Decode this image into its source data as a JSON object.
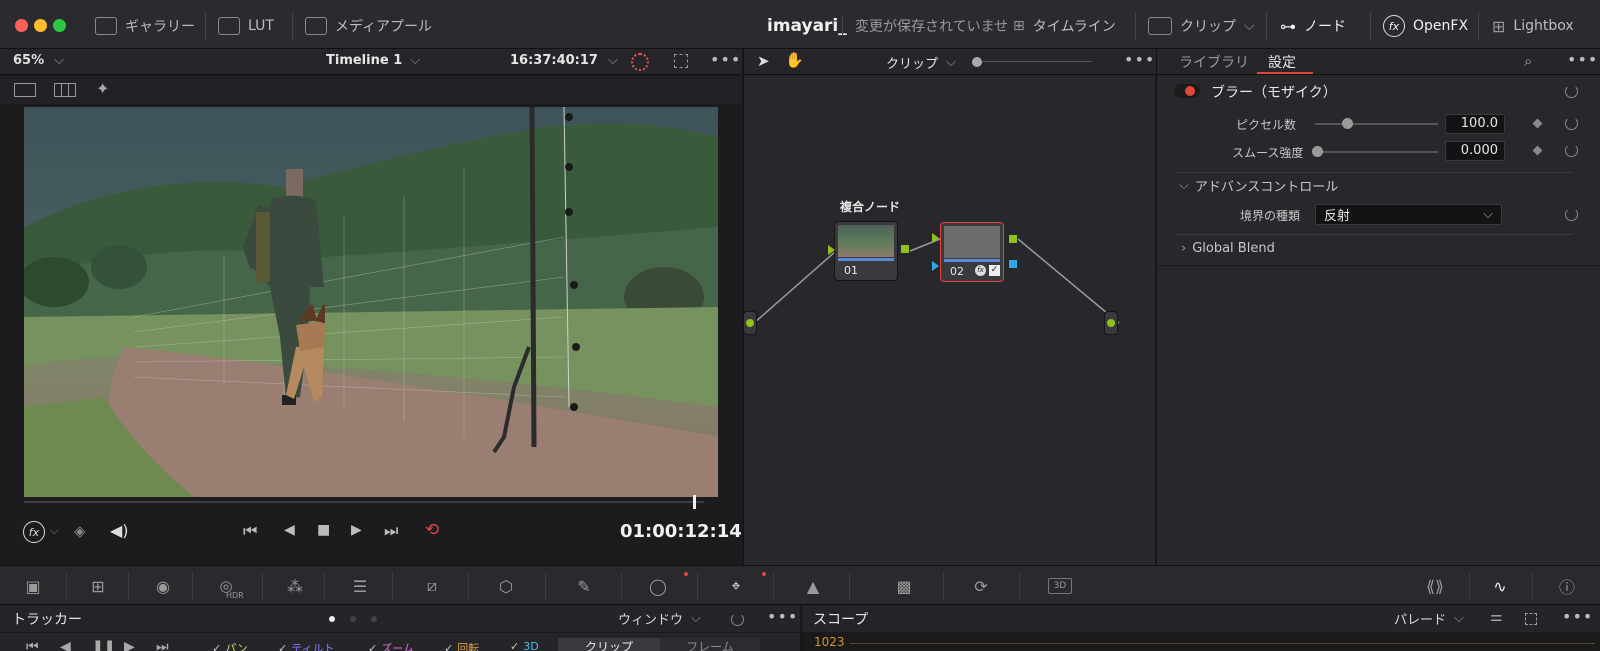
{
  "titlebar": {
    "gallery": "ギャラリー",
    "lut": "LUT",
    "media_pool": "メディアプール",
    "project_name": "imayari_",
    "save_status": "変更が保存されていませ",
    "timeline": "タイムライン",
    "clip": "クリップ",
    "node": "ノード",
    "openfx": "OpenFX",
    "lightbox": "Lightbox"
  },
  "viewer": {
    "zoom": "65%",
    "timeline_name": "Timeline 1",
    "source_timecode": "16:37:40:17",
    "timecode": "01:00:12:14",
    "playhead_fraction": 0.985
  },
  "nodes": {
    "mode": "クリップ",
    "composite_label": "複合ノード",
    "node1_number": "01",
    "node2_number": "02"
  },
  "inspector": {
    "tab_library": "ライブラリ",
    "tab_settings": "設定",
    "effect_name": "ブラー（モザイク）",
    "pixel_count_label": "ピクセル数",
    "pixel_count_value": "100.0",
    "smooth_label": "スムース強度",
    "smooth_value": "0.000",
    "advanced_label": "アドバンスコントロール",
    "border_type_label": "境界の種類",
    "border_type_value": "反射",
    "global_blend": "Global Blend"
  },
  "palette": {
    "hdr_label": "HDR",
    "three_d_label": "3D"
  },
  "tracker": {
    "title": "トラッカー",
    "window": "ウィンドウ",
    "clip": "クリップ",
    "frame": "フレーム",
    "checks": [
      "パン",
      "ティルト",
      "ズーム",
      "回転",
      "3D"
    ]
  },
  "scope": {
    "title": "スコープ",
    "mode": "パレード",
    "top_value": "1023"
  },
  "colors": {
    "accent_red": "#e0463c",
    "node_green": "#8fc21b",
    "node_blue": "#2fa8e8",
    "timecode_white": "#f2f2f2"
  }
}
